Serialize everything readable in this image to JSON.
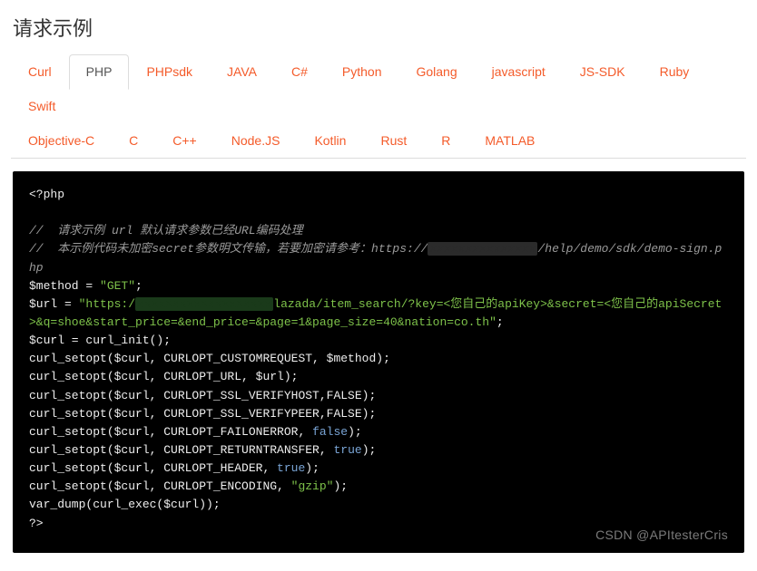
{
  "title": "请求示例",
  "tabs": {
    "row1": [
      "Curl",
      "PHP",
      "PHPsdk",
      "JAVA",
      "C#",
      "Python",
      "Golang",
      "javascript",
      "JS-SDK",
      "Ruby",
      "Swift"
    ],
    "row2": [
      "Objective-C",
      "C",
      "C++",
      "Node.JS",
      "Kotlin",
      "Rust",
      "R",
      "MATLAB"
    ],
    "active": "PHP"
  },
  "code": {
    "open": "<?php",
    "comment1": "//  请求示例 url 默认请求参数已经URL编码处理",
    "comment2_prefix": "//  本示例代码未加密secret参数明文传输，若要加密请参考：https://",
    "comment2_suffix": "/help/demo/sdk/demo-sign.php",
    "l_method_pre": "$method = ",
    "l_method_str": "\"GET\"",
    "l_url_pre": "$url = ",
    "l_url_str_a": "\"https:/",
    "l_url_str_b": "lazada/item_search/?key=<您自己的apiKey>&secret=<您自己的apiSecret>&q=shoe&start_price=&end_price=&page=1&page_size=40&nation=co.th\"",
    "l_curl_init": "$curl = curl_init();",
    "l_opt1": "curl_setopt($curl, CURLOPT_CUSTOMREQUEST, $method);",
    "l_opt2": "curl_setopt($curl, CURLOPT_URL, $url);",
    "l_opt3": "curl_setopt($curl, CURLOPT_SSL_VERIFYHOST,FALSE);",
    "l_opt4": "curl_setopt($curl, CURLOPT_SSL_VERIFYPEER,FALSE);",
    "l_opt5_pre": "curl_setopt($curl, CURLOPT_FAILONERROR, ",
    "l_opt5_bool": "false",
    "l_opt6_pre": "curl_setopt($curl, CURLOPT_RETURNTRANSFER, ",
    "l_opt6_bool": "true",
    "l_opt7_pre": "curl_setopt($curl, CURLOPT_HEADER, ",
    "l_opt7_bool": "true",
    "l_opt8_pre": "curl_setopt($curl, CURLOPT_ENCODING, ",
    "l_opt8_str": "\"gzip\"",
    "l_exec": "var_dump(curl_exec($curl));",
    "close_tag": "?>",
    "paren_semi": ");",
    "semi": ";"
  },
  "watermark": "CSDN @APItesterCris"
}
